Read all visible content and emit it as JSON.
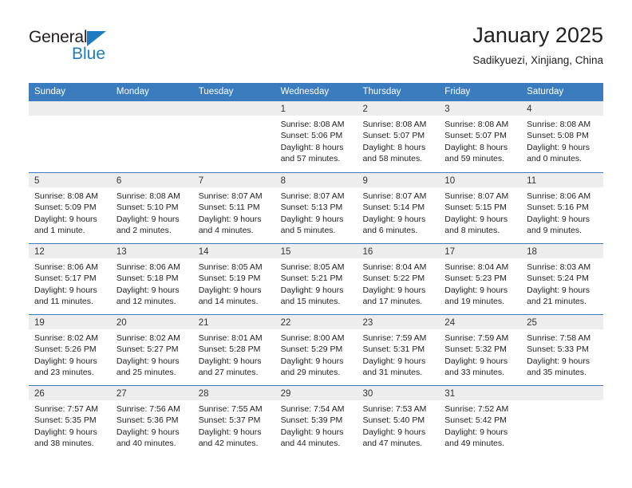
{
  "logo": {
    "word1": "General",
    "word2": "Blue",
    "triangle_color": "#1f7bc1"
  },
  "header": {
    "title": "January 2025",
    "subtitle": "Sadikyuezi, Xinjiang, China"
  },
  "theme": {
    "header_blue": "#3a7cbe",
    "day_band_gray": "#ededed",
    "text": "#222222"
  },
  "weekdays": [
    "Sunday",
    "Monday",
    "Tuesday",
    "Wednesday",
    "Thursday",
    "Friday",
    "Saturday"
  ],
  "weeks": [
    [
      {
        "day": "",
        "lines": []
      },
      {
        "day": "",
        "lines": []
      },
      {
        "day": "",
        "lines": []
      },
      {
        "day": "1",
        "lines": [
          "Sunrise: 8:08 AM",
          "Sunset: 5:06 PM",
          "Daylight: 8 hours",
          "and 57 minutes."
        ]
      },
      {
        "day": "2",
        "lines": [
          "Sunrise: 8:08 AM",
          "Sunset: 5:07 PM",
          "Daylight: 8 hours",
          "and 58 minutes."
        ]
      },
      {
        "day": "3",
        "lines": [
          "Sunrise: 8:08 AM",
          "Sunset: 5:07 PM",
          "Daylight: 8 hours",
          "and 59 minutes."
        ]
      },
      {
        "day": "4",
        "lines": [
          "Sunrise: 8:08 AM",
          "Sunset: 5:08 PM",
          "Daylight: 9 hours",
          "and 0 minutes."
        ]
      }
    ],
    [
      {
        "day": "5",
        "lines": [
          "Sunrise: 8:08 AM",
          "Sunset: 5:09 PM",
          "Daylight: 9 hours",
          "and 1 minute."
        ]
      },
      {
        "day": "6",
        "lines": [
          "Sunrise: 8:08 AM",
          "Sunset: 5:10 PM",
          "Daylight: 9 hours",
          "and 2 minutes."
        ]
      },
      {
        "day": "7",
        "lines": [
          "Sunrise: 8:07 AM",
          "Sunset: 5:11 PM",
          "Daylight: 9 hours",
          "and 4 minutes."
        ]
      },
      {
        "day": "8",
        "lines": [
          "Sunrise: 8:07 AM",
          "Sunset: 5:13 PM",
          "Daylight: 9 hours",
          "and 5 minutes."
        ]
      },
      {
        "day": "9",
        "lines": [
          "Sunrise: 8:07 AM",
          "Sunset: 5:14 PM",
          "Daylight: 9 hours",
          "and 6 minutes."
        ]
      },
      {
        "day": "10",
        "lines": [
          "Sunrise: 8:07 AM",
          "Sunset: 5:15 PM",
          "Daylight: 9 hours",
          "and 8 minutes."
        ]
      },
      {
        "day": "11",
        "lines": [
          "Sunrise: 8:06 AM",
          "Sunset: 5:16 PM",
          "Daylight: 9 hours",
          "and 9 minutes."
        ]
      }
    ],
    [
      {
        "day": "12",
        "lines": [
          "Sunrise: 8:06 AM",
          "Sunset: 5:17 PM",
          "Daylight: 9 hours",
          "and 11 minutes."
        ]
      },
      {
        "day": "13",
        "lines": [
          "Sunrise: 8:06 AM",
          "Sunset: 5:18 PM",
          "Daylight: 9 hours",
          "and 12 minutes."
        ]
      },
      {
        "day": "14",
        "lines": [
          "Sunrise: 8:05 AM",
          "Sunset: 5:19 PM",
          "Daylight: 9 hours",
          "and 14 minutes."
        ]
      },
      {
        "day": "15",
        "lines": [
          "Sunrise: 8:05 AM",
          "Sunset: 5:21 PM",
          "Daylight: 9 hours",
          "and 15 minutes."
        ]
      },
      {
        "day": "16",
        "lines": [
          "Sunrise: 8:04 AM",
          "Sunset: 5:22 PM",
          "Daylight: 9 hours",
          "and 17 minutes."
        ]
      },
      {
        "day": "17",
        "lines": [
          "Sunrise: 8:04 AM",
          "Sunset: 5:23 PM",
          "Daylight: 9 hours",
          "and 19 minutes."
        ]
      },
      {
        "day": "18",
        "lines": [
          "Sunrise: 8:03 AM",
          "Sunset: 5:24 PM",
          "Daylight: 9 hours",
          "and 21 minutes."
        ]
      }
    ],
    [
      {
        "day": "19",
        "lines": [
          "Sunrise: 8:02 AM",
          "Sunset: 5:26 PM",
          "Daylight: 9 hours",
          "and 23 minutes."
        ]
      },
      {
        "day": "20",
        "lines": [
          "Sunrise: 8:02 AM",
          "Sunset: 5:27 PM",
          "Daylight: 9 hours",
          "and 25 minutes."
        ]
      },
      {
        "day": "21",
        "lines": [
          "Sunrise: 8:01 AM",
          "Sunset: 5:28 PM",
          "Daylight: 9 hours",
          "and 27 minutes."
        ]
      },
      {
        "day": "22",
        "lines": [
          "Sunrise: 8:00 AM",
          "Sunset: 5:29 PM",
          "Daylight: 9 hours",
          "and 29 minutes."
        ]
      },
      {
        "day": "23",
        "lines": [
          "Sunrise: 7:59 AM",
          "Sunset: 5:31 PM",
          "Daylight: 9 hours",
          "and 31 minutes."
        ]
      },
      {
        "day": "24",
        "lines": [
          "Sunrise: 7:59 AM",
          "Sunset: 5:32 PM",
          "Daylight: 9 hours",
          "and 33 minutes."
        ]
      },
      {
        "day": "25",
        "lines": [
          "Sunrise: 7:58 AM",
          "Sunset: 5:33 PM",
          "Daylight: 9 hours",
          "and 35 minutes."
        ]
      }
    ],
    [
      {
        "day": "26",
        "lines": [
          "Sunrise: 7:57 AM",
          "Sunset: 5:35 PM",
          "Daylight: 9 hours",
          "and 38 minutes."
        ]
      },
      {
        "day": "27",
        "lines": [
          "Sunrise: 7:56 AM",
          "Sunset: 5:36 PM",
          "Daylight: 9 hours",
          "and 40 minutes."
        ]
      },
      {
        "day": "28",
        "lines": [
          "Sunrise: 7:55 AM",
          "Sunset: 5:37 PM",
          "Daylight: 9 hours",
          "and 42 minutes."
        ]
      },
      {
        "day": "29",
        "lines": [
          "Sunrise: 7:54 AM",
          "Sunset: 5:39 PM",
          "Daylight: 9 hours",
          "and 44 minutes."
        ]
      },
      {
        "day": "30",
        "lines": [
          "Sunrise: 7:53 AM",
          "Sunset: 5:40 PM",
          "Daylight: 9 hours",
          "and 47 minutes."
        ]
      },
      {
        "day": "31",
        "lines": [
          "Sunrise: 7:52 AM",
          "Sunset: 5:42 PM",
          "Daylight: 9 hours",
          "and 49 minutes."
        ]
      },
      {
        "day": "",
        "lines": []
      }
    ]
  ]
}
